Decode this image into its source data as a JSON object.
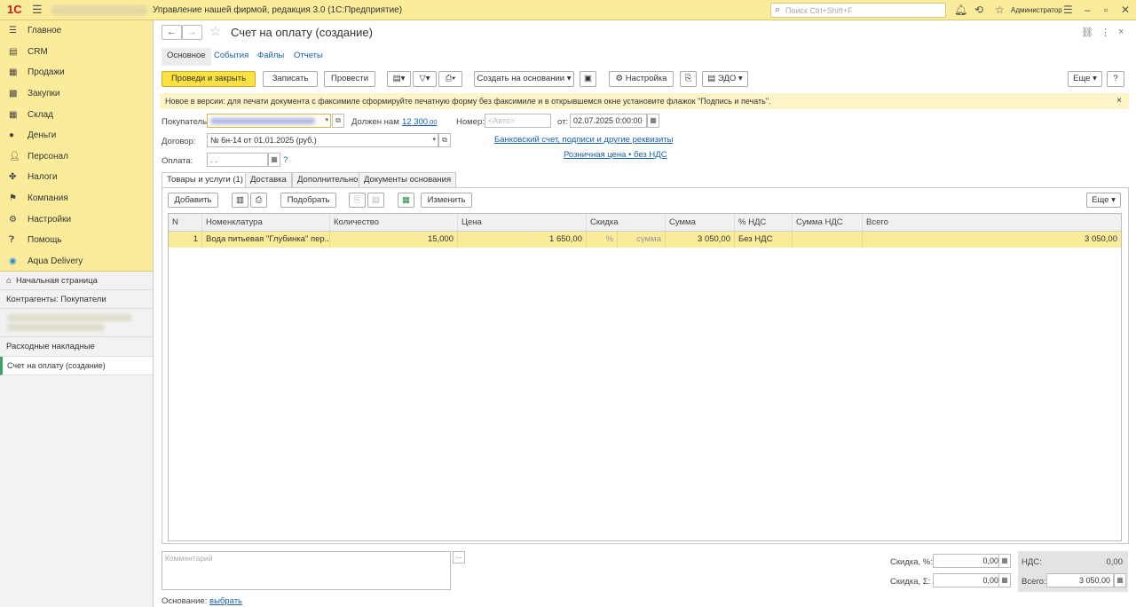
{
  "topbar": {
    "logo": "1С",
    "app_title": "Управление нашей фирмой, редакция 3.0  (1С:Предприятие)",
    "search_placeholder": "Поиск Ctrl+Shift+F",
    "user": "Администратор",
    "icons": [
      "bell-icon",
      "history-icon",
      "star-icon",
      "settings-icon",
      "minimize-icon",
      "restore-icon",
      "close-icon"
    ]
  },
  "sidebar": {
    "items": [
      {
        "label": "Главное",
        "icon": "menu-icon"
      },
      {
        "label": "CRM",
        "icon": "crm-icon"
      },
      {
        "label": "Продажи",
        "icon": "sales-icon"
      },
      {
        "label": "Закупки",
        "icon": "purchases-icon"
      },
      {
        "label": "Склад",
        "icon": "warehouse-icon"
      },
      {
        "label": "Деньги",
        "icon": "money-icon"
      },
      {
        "label": "Персонал",
        "icon": "staff-icon"
      },
      {
        "label": "Налоги",
        "icon": "taxes-icon"
      },
      {
        "label": "Компания",
        "icon": "flag-icon"
      },
      {
        "label": "Настройки",
        "icon": "gear-icon"
      },
      {
        "label": "Помощь",
        "icon": "help-icon"
      },
      {
        "label": "Aqua Delivery",
        "icon": "location-icon"
      }
    ],
    "open_windows": {
      "home": "Начальная страница",
      "counterparties": "Контрагенты: Покупатели",
      "invoices": "Расходные накладные",
      "current": "Счет на оплату (создание)"
    }
  },
  "header": {
    "title": "Счет на оплату (создание)",
    "back": "←",
    "forward": "→",
    "star": "☆",
    "link_icon": "🔗",
    "more_icon": "⋮",
    "close_icon": "×"
  },
  "form_tabs": [
    "Основное",
    "События",
    "Файлы",
    "Отчеты"
  ],
  "toolbar": {
    "post_close": "Проведи и закрыть",
    "save": "Записать",
    "post": "Провести",
    "create_based": "Создать на основании",
    "settings": "Настройка",
    "edo": "ЭДО",
    "more": "Еще",
    "help": "?"
  },
  "notice": {
    "text": "Новое в версии: для печати документа с факсимиле сформируйте печатную форму без факсимиле и в открывшемся окне установите флажок \"Подпись и печать\".",
    "close": "×"
  },
  "form": {
    "buyer_label": "Покупатель:",
    "owes_label": "Должен нам",
    "owes_amount": "12 300",
    "owes_cents": ",00",
    "number_label": "Номер:",
    "number_placeholder": "<Авто>",
    "date_label": "от:",
    "date_value": "02.07.2025  0:00:00",
    "contract_label": "Договор:",
    "contract_value": "№ 6н-14 от 01.01.2025 (руб.)",
    "bank_link": "Банковский счет, подписи и другие реквизиты",
    "payment_label": "Оплата:",
    "payment_value": " .  .",
    "payment_help": "?",
    "price_link": "Розничная цена • без НДС"
  },
  "lower_tabs": [
    "Товары и услуги (1)",
    "Доставка",
    "Дополнительно",
    "Документы основания"
  ],
  "table_toolbar": {
    "add": "Добавить",
    "pick": "Подобрать",
    "change": "Изменить",
    "more": "Еще"
  },
  "table": {
    "headers": [
      "N",
      "Номенклатура",
      "Количество",
      "Цена",
      "Скидка",
      "Сумма",
      "% НДС",
      "Сумма НДС",
      "Всего"
    ],
    "rows": [
      {
        "n": "1",
        "name": "Вода питьевая \"Глубинка\" пер...",
        "qty": "15,000",
        "price": "1 650,00",
        "disc_pct": "%",
        "disc_sum": "сумма",
        "sum": "3 050,00",
        "vat_rate": "Без НДС",
        "vat_sum": "",
        "total": "3 050,00"
      }
    ]
  },
  "footer": {
    "comment_placeholder": "Комментарий",
    "comment_btn": "...",
    "discount_pct_label": "Скидка, %:",
    "discount_pct_value": "0,00",
    "discount_sum_label": "Скидка, Σ:",
    "discount_sum_value": "0,00",
    "vat_label": "НДС:",
    "vat_value": "0,00",
    "total_label": "Всего:",
    "total_value": "3 050,00",
    "basis_label": "Основание:",
    "basis_link": "выбрать"
  }
}
